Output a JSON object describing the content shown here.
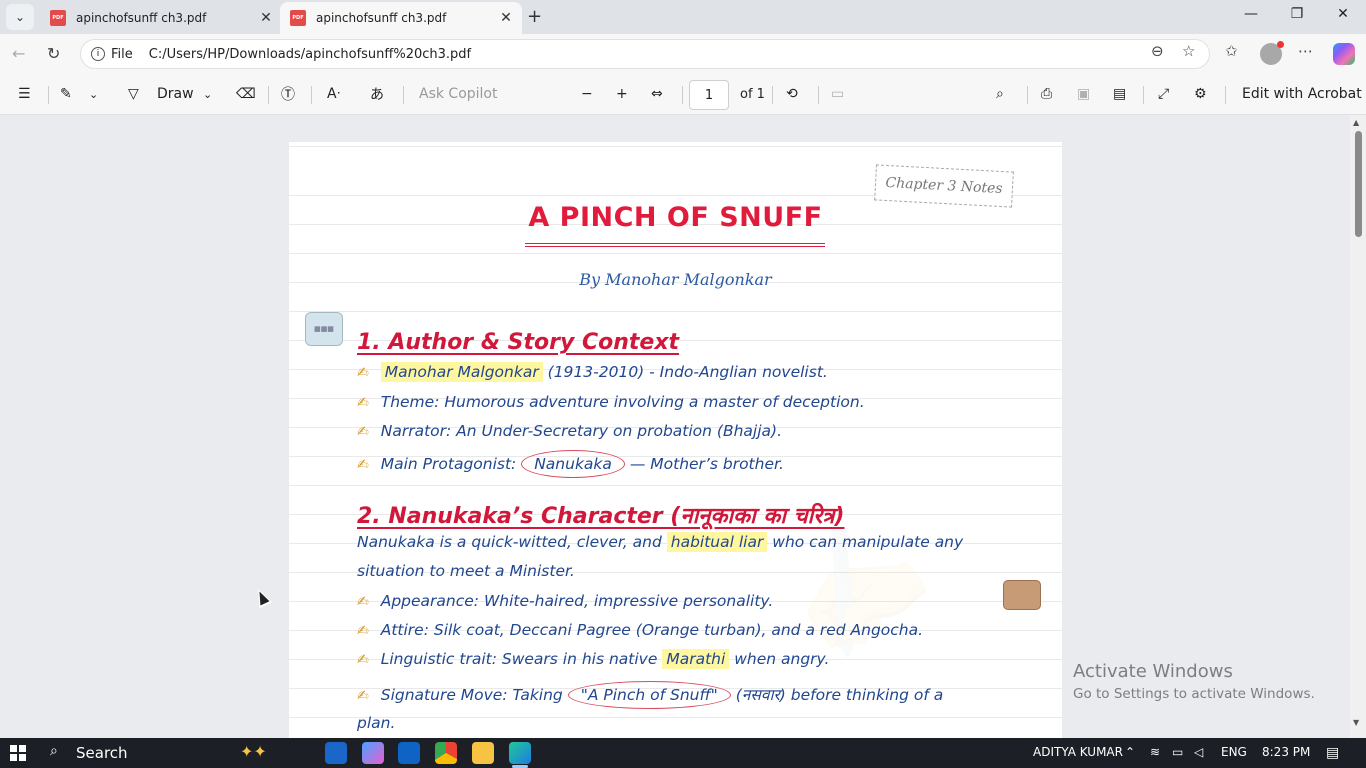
{
  "browser": {
    "tabs": [
      {
        "title": "apinchofsunff ch3.pdf",
        "active": false
      },
      {
        "title": "apinchofsunff ch3.pdf",
        "active": true
      }
    ],
    "new_tab_label": "+",
    "address_prefix": "File",
    "url": "C:/Users/HP/Downloads/apinchofsunff%20ch3.pdf"
  },
  "pdf_toolbar": {
    "draw_label": "Draw",
    "ask_copilot": "Ask Copilot",
    "page_current": "1",
    "page_of": "of 1",
    "edit_acrobat": "Edit with Acrobat"
  },
  "document": {
    "stamp": "Chapter 3 Notes",
    "title": "A PINCH OF SNUFF",
    "byline": "By Manohar Malgonkar",
    "section1": {
      "heading": "1. Author & Story Context",
      "items": [
        {
          "pre": "",
          "hl": "Manohar Malgonkar",
          "post": " (1913-2010) - Indo-Anglian novelist."
        },
        {
          "text": "Theme: Humorous adventure involving a master of deception."
        },
        {
          "text": "Narrator: An Under-Secretary on probation (Bhajja)."
        },
        {
          "pre": "Main Protagonist: ",
          "circled": "Nanukaka",
          "post": " — Mother’s brother."
        }
      ]
    },
    "section2": {
      "heading": "2. Nanukaka’s Character (नानूकाका का चरित्र)",
      "intro_pre": "Nanukaka is a quick-witted, clever, and ",
      "intro_hl": "habitual liar",
      "intro_post": " who can manipulate any",
      "intro_line2": "situation to meet a Minister.",
      "items": [
        {
          "text": "Appearance: White-haired, impressive personality."
        },
        {
          "text": "Attire: Silk coat, Deccani Pagree (Orange turban), and a red Angocha."
        },
        {
          "pre": "Linguistic trait: Swears in his native ",
          "hl": "Marathi",
          "post": " when angry."
        },
        {
          "pre": "Signature Move: Taking ",
          "circled": "\"A Pinch of Snuff\"",
          "post": " (नसवार) before thinking of a"
        }
      ],
      "last_line": "plan."
    },
    "bullet_glyph": "✍"
  },
  "os": {
    "activate_title": "Activate Windows",
    "activate_sub": "Go to Settings to activate Windows.",
    "search_label": "Search",
    "user": "ADITYA KUMAR",
    "lang": "ENG",
    "time": "8:23 PM"
  },
  "colors": {
    "heading_red": "#d1173a",
    "body_blue": "#21478f",
    "highlight": "#fff7a0"
  }
}
